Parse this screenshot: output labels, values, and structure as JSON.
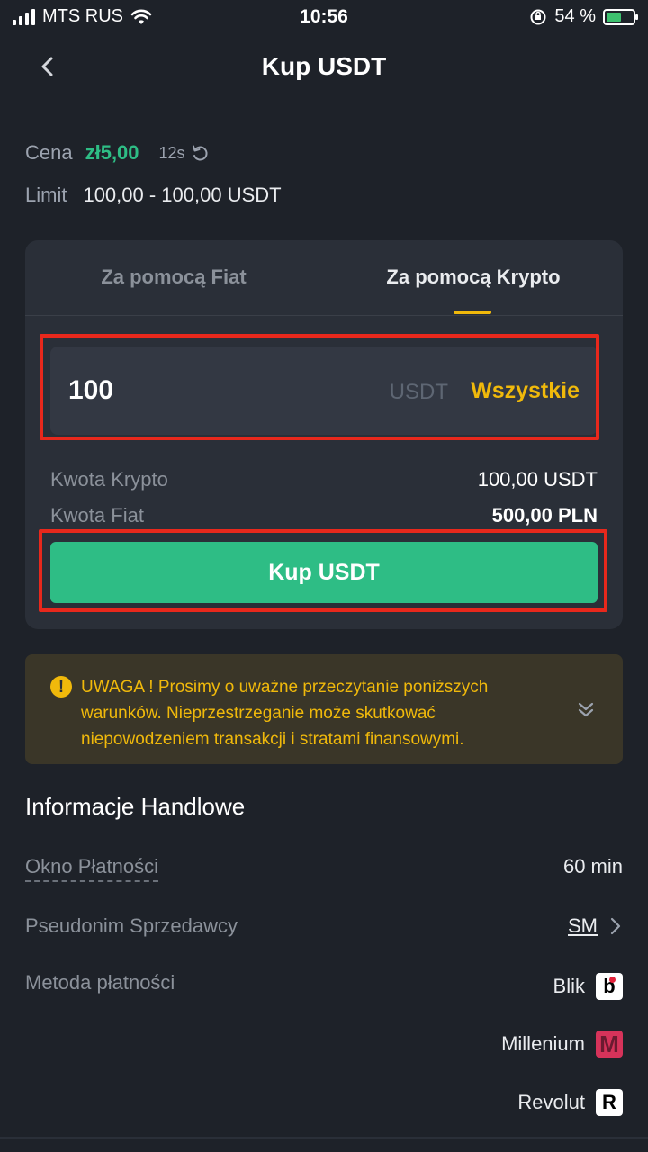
{
  "status_bar": {
    "carrier": "MTS RUS",
    "time": "10:56",
    "battery": "54 %"
  },
  "header": {
    "title": "Kup USDT"
  },
  "price": {
    "label": "Cena",
    "value": "zł5,00",
    "timer": "12s"
  },
  "limit": {
    "label": "Limit",
    "value": "100,00 - 100,00 USDT"
  },
  "tabs": [
    {
      "label": "Za pomocą Fiat"
    },
    {
      "label": "Za pomocą Krypto"
    }
  ],
  "amount": {
    "value": "100",
    "unit": "USDT",
    "all_label": "Wszystkie"
  },
  "summary": {
    "crypto_label": "Kwota Krypto",
    "crypto_value": "100,00 USDT",
    "fiat_label": "Kwota Fiat",
    "fiat_value": "500,00 PLN"
  },
  "buy_button": {
    "label": "Kup USDT"
  },
  "warning": {
    "text": "UWAGA ! Prosimy o uważne przeczytanie poniższych warunków. Nieprzestrzeganie może skutkować niepowodzeniem transakcji i stratami finansowymi."
  },
  "trade_info": {
    "title": "Informacje Handlowe",
    "payment_window_label": "Okno Płatności",
    "payment_window_value": "60 min",
    "seller_label": "Pseudonim Sprzedawcy",
    "seller_value": "SM",
    "payment_method_label": "Metoda płatności",
    "methods": [
      {
        "name": "Blik",
        "logo_letter": "b"
      },
      {
        "name": "Millenium",
        "logo_letter": "M"
      },
      {
        "name": "Revolut",
        "logo_letter": "R"
      }
    ]
  },
  "colors": {
    "background": "#1e2229",
    "card": "#2a2f38",
    "green": "#2ebd85",
    "yellow": "#f0b90b",
    "highlight_red": "#e8281c"
  }
}
